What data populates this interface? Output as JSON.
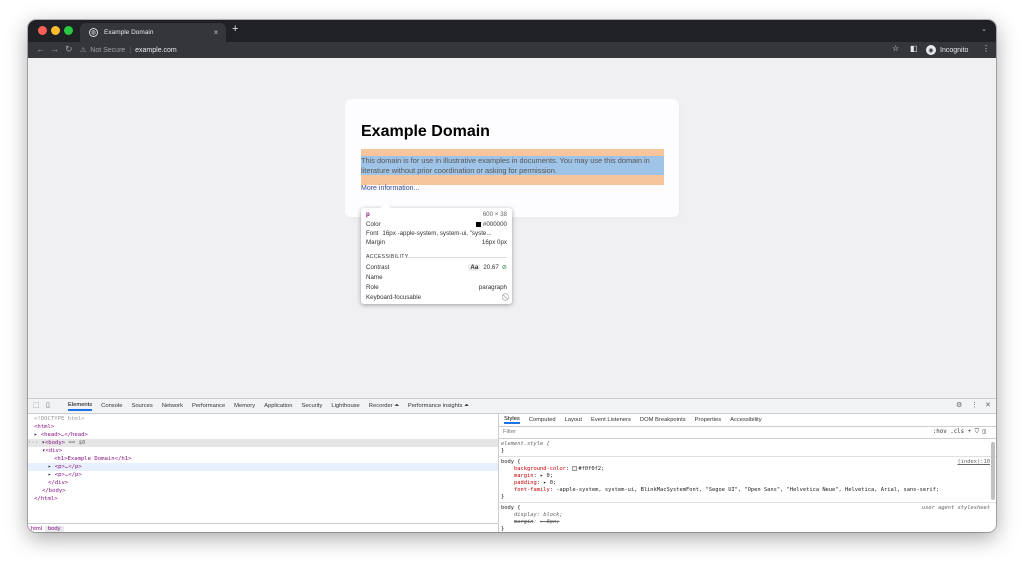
{
  "browser": {
    "tab_title": "Example Domain",
    "tab_close": "×",
    "new_tab": "+",
    "chevron": "⌄",
    "not_secure": "Not Secure",
    "separator": "|",
    "url": "example.com",
    "profile_label": "Incognito"
  },
  "page": {
    "heading": "Example Domain",
    "paragraph": "This domain is for use in illustrative examples in documents. You may use this domain in literature without prior coordination or asking for permission.",
    "more_link": "More information..."
  },
  "tooltip": {
    "tag": "p",
    "size": "600 × 38",
    "color_label": "Color",
    "color_value": "#000000",
    "font_label": "Font",
    "font_value": "16px -apple-system, system-ui, \"syste...",
    "margin_label": "Margin",
    "margin_value": "16px 0px",
    "section": "ACCESSIBILITY",
    "contrast_label": "Contrast",
    "contrast_aa": "Aa",
    "contrast_value": "20.67",
    "name_label": "Name",
    "role_label": "Role",
    "role_value": "paragraph",
    "keyboard_label": "Keyboard-focusable"
  },
  "devtools": {
    "tabs": [
      "Elements",
      "Console",
      "Sources",
      "Network",
      "Performance",
      "Memory",
      "Application",
      "Security",
      "Lighthouse",
      "Recorder ⏶",
      "Performance insights ⏶"
    ],
    "dom": {
      "doctype": "<!DOCTYPE html>",
      "html_open": "<html>",
      "head": "<head>…</head>",
      "body_open": "<body>",
      "body_eq": "== $0",
      "div_open": "<div>",
      "h1": "<h1>Example Domain</h1>",
      "p1": "<p>…</p>",
      "p2": "<p>…</p>",
      "div_close": "</div>",
      "body_close": "</body>",
      "html_close": "</html>"
    },
    "breadcrumbs": [
      "html",
      "body"
    ],
    "styles_tabs": [
      "Styles",
      "Computed",
      "Layout",
      "Event Listeners",
      "DOM Breakpoints",
      "Properties",
      "Accessibility"
    ],
    "filter_placeholder": "Filter",
    "filter_controls": ":hov  .cls  +",
    "rules": {
      "element_style": "element.style {",
      "close": "}",
      "body_sel": "body {",
      "body_src": "(index):10",
      "bg_prop": "background-color",
      "bg_val": "#f0f0f2;",
      "margin_prop": "margin",
      "margin_val": "▸ 0;",
      "padding_prop": "padding",
      "padding_val": "▸ 0;",
      "font_prop": "font-family",
      "font_val": "-apple-system, system-ui, BlinkMacSystemFont, \"Segoe UI\", \"Open Sans\", \"Helvetica Neue\", Helvetica, Arial, sans-serif;",
      "ua_sel": "body {",
      "ua_src": "user agent stylesheet",
      "display_prop": "display",
      "display_val": "block;",
      "ua_margin_prop": "margin",
      "ua_margin_val": "▸ 8px;"
    }
  },
  "colors": {
    "chrome_dark": "#202124",
    "toolbar": "#35363a",
    "page_bg": "#f0f0f2",
    "margin_highlight": "#f6c59b",
    "content_highlight": "#9fc4e7",
    "devtools_active": "#1a73e8"
  },
  "icons": [
    "back-arrow-icon",
    "forward-arrow-icon",
    "reload-icon",
    "warning-icon",
    "star-icon",
    "sidepanel-icon",
    "incognito-icon",
    "kebab-menu-icon",
    "inspect-icon",
    "device-toolbar-icon",
    "settings-icon",
    "close-icon"
  ]
}
